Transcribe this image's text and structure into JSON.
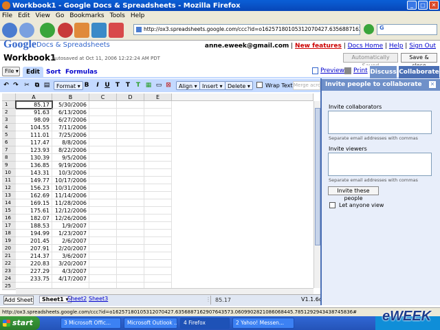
{
  "window": {
    "title": "Workbook1 - Google Docs & Spreadsheets - Mozilla Firefox"
  },
  "menu": [
    "File",
    "Edit",
    "View",
    "Go",
    "Bookmarks",
    "Tools",
    "Help"
  ],
  "address": {
    "url": "http://ox3.spreadsheets.google.com/ccc?id=o16257180105312070427.6356887162907643573.0",
    "search_value": "G"
  },
  "header": {
    "logo_google": "Google",
    "logo_sub": "Docs & Spreadsheets",
    "email": "anne.eweek@gmail.com",
    "links": [
      "New features",
      "Docs Home",
      "Help",
      "Sign Out"
    ],
    "doc_title": "Workbook1",
    "autosaved": "Autosaved at Oct 11, 2006 12:22:24 AM PDT",
    "btn_saved": "Automatically Saved",
    "btn_close": "Save & close"
  },
  "tabs": {
    "file": "File",
    "items": [
      "Edit",
      "Sort",
      "Formulas"
    ],
    "preview": "Preview",
    "print": "Print",
    "discuss": "Discuss",
    "collaborate": "Collaborate"
  },
  "toolbar": {
    "format": "Format",
    "align": "Align",
    "insert": "Insert",
    "delete": "Delete",
    "wrap": "Wrap Text",
    "merge": "Merge across"
  },
  "columns": [
    "A",
    "B",
    "C",
    "D",
    "E"
  ],
  "rows": [
    [
      "85.17",
      "5/30/2006"
    ],
    [
      "91.63",
      "6/13/2006"
    ],
    [
      "98.09",
      "6/27/2006"
    ],
    [
      "104.55",
      "7/11/2006"
    ],
    [
      "111.01",
      "7/25/2006"
    ],
    [
      "117.47",
      "8/8/2006"
    ],
    [
      "123.93",
      "8/22/2006"
    ],
    [
      "130.39",
      "9/5/2006"
    ],
    [
      "136.85",
      "9/19/2006"
    ],
    [
      "143.31",
      "10/3/2006"
    ],
    [
      "149.77",
      "10/17/2006"
    ],
    [
      "156.23",
      "10/31/2006"
    ],
    [
      "162.69",
      "11/14/2006"
    ],
    [
      "169.15",
      "11/28/2006"
    ],
    [
      "175.61",
      "12/12/2006"
    ],
    [
      "182.07",
      "12/26/2006"
    ],
    [
      "188.53",
      "1/9/2007"
    ],
    [
      "194.99",
      "1/23/2007"
    ],
    [
      "201.45",
      "2/6/2007"
    ],
    [
      "207.91",
      "2/20/2007"
    ],
    [
      "214.37",
      "3/6/2007"
    ],
    [
      "220.83",
      "3/20/2007"
    ],
    [
      "227.29",
      "4/3/2007"
    ],
    [
      "233.75",
      "4/17/2007"
    ],
    [
      "",
      ""
    ]
  ],
  "sheets": {
    "add": "Add Sheet",
    "tabs": [
      "Sheet1",
      "Sheet2",
      "Sheet3"
    ],
    "cell_value": "85.17",
    "version": "V1.1.6c"
  },
  "panel": {
    "title": "Invite people to collaborate",
    "collab_label": "Invite collaborators",
    "collab_hint": "Separate email addresses with commas",
    "viewer_label": "Invite viewers",
    "viewer_hint": "Separate email addresses with commas",
    "invite_btn": "Invite these people",
    "anyone_label": "Let anyone view"
  },
  "status": "http://ox3.spreadsheets.google.com/ccc?id=o16257180105312070427.6356887162907643573.0609902821086068445.7851292943438745836#",
  "taskbar": {
    "start": "start",
    "tasks": [
      "3 Microsoft Offic...",
      "Microsoft Outlook ...",
      "4 Firefox",
      "2 Yahoo! Messen..."
    ],
    "brand": "eWEEK"
  }
}
